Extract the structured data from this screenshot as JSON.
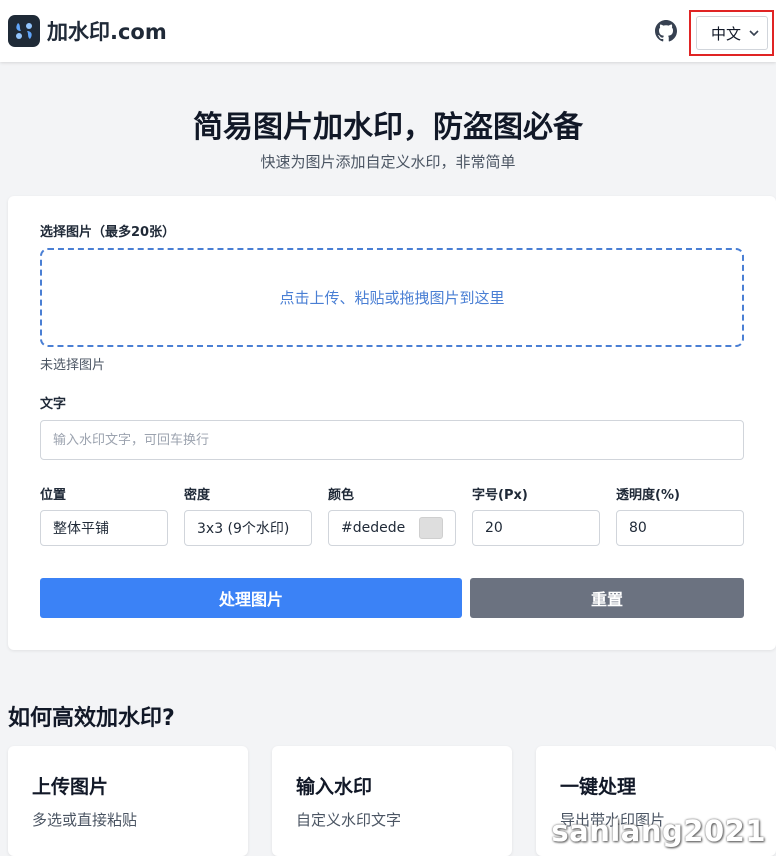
{
  "header": {
    "brand": "加水印.com",
    "language": "中文"
  },
  "hero": {
    "title": "简易图片加水印，防盗图必备",
    "subtitle": "快速为图片添加自定义水印，非常简单"
  },
  "form": {
    "image_label": "选择图片（最多20张）",
    "dropzone_text": "点击上传、粘贴或拖拽图片到这里",
    "no_file_text": "未选择图片",
    "text_label": "文字",
    "text_placeholder": "输入水印文字，可回车换行",
    "position_label": "位置",
    "position_value": "整体平铺",
    "density_label": "密度",
    "density_value": "3x3 (9个水印)",
    "color_label": "颜色",
    "color_value": "#dedede",
    "font_size_label": "字号(Px)",
    "font_size_value": "20",
    "opacity_label": "透明度(%)",
    "opacity_value": "80",
    "process_button": "处理图片",
    "reset_button": "重置"
  },
  "howto": {
    "title": "如何高效加水印?",
    "steps": [
      {
        "title": "上传图片",
        "desc": "多选或直接粘贴"
      },
      {
        "title": "输入水印",
        "desc": "自定义水印文字"
      },
      {
        "title": "一键处理",
        "desc": "导出带水印图片"
      }
    ]
  },
  "overlay_watermark": "sanlang2021",
  "colors": {
    "primary": "#3b82f6",
    "secondary": "#6b7280",
    "dropzone": "#4a7fd4",
    "highlight": "#e02424",
    "swatch": "#dedede"
  }
}
